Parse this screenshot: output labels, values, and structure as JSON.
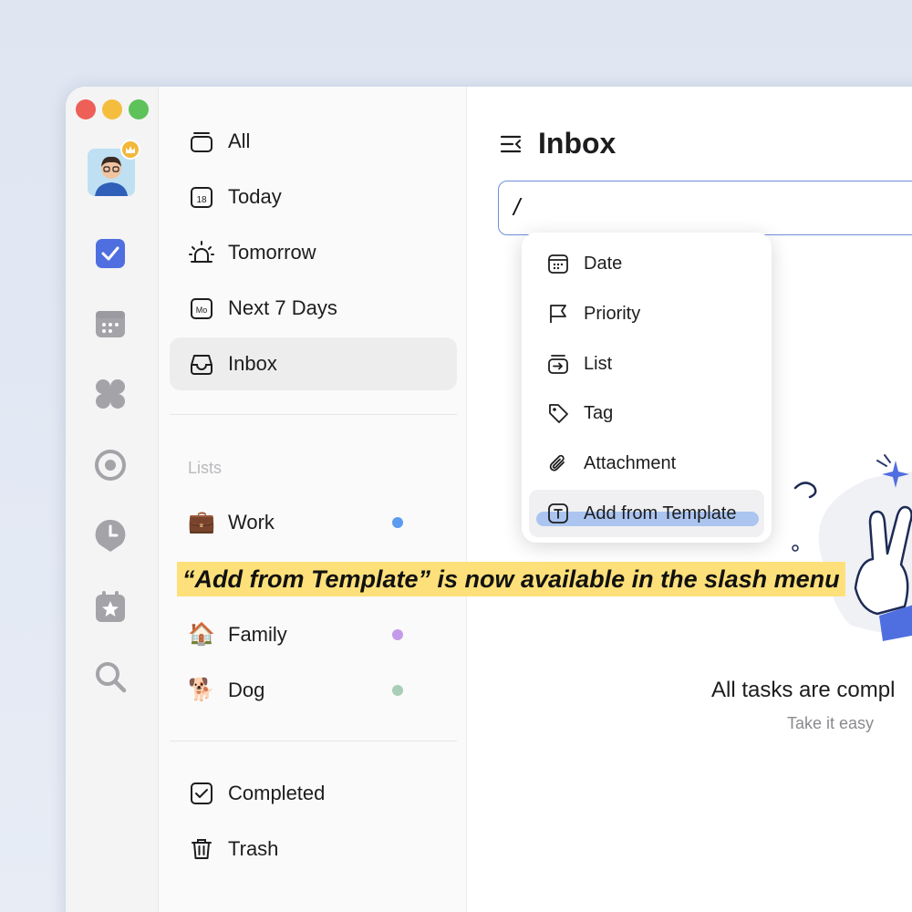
{
  "sidebar": {
    "smart_lists": [
      {
        "label": "All",
        "icon": "stack-icon"
      },
      {
        "label": "Today",
        "icon": "calendar-18-icon",
        "badge": "18"
      },
      {
        "label": "Tomorrow",
        "icon": "sunrise-icon"
      },
      {
        "label": "Next 7 Days",
        "icon": "calendar-mo-icon",
        "badge": "Mo"
      },
      {
        "label": "Inbox",
        "icon": "inbox-icon"
      }
    ],
    "lists_header": "Lists",
    "lists": [
      {
        "label": "Work",
        "emoji": "💼",
        "color": "#5b9cf0"
      },
      {
        "label": "Family",
        "emoji": "🏠",
        "color": "#c39bea"
      },
      {
        "label": "Dog",
        "emoji": "🐕",
        "color": "#a9cdb6"
      }
    ],
    "bottom": [
      {
        "label": "Completed",
        "icon": "checkbox-icon"
      },
      {
        "label": "Trash",
        "icon": "trash-icon"
      }
    ]
  },
  "main": {
    "title": "Inbox",
    "input_value": "/",
    "empty_title": "All tasks are compl",
    "empty_subtitle": "Take it easy"
  },
  "slash_menu": {
    "items": [
      {
        "label": "Date",
        "icon": "calendar-icon"
      },
      {
        "label": "Priority",
        "icon": "flag-icon"
      },
      {
        "label": "List",
        "icon": "list-move-icon"
      },
      {
        "label": "Tag",
        "icon": "tag-icon"
      },
      {
        "label": "Attachment",
        "icon": "paperclip-icon"
      },
      {
        "label": "Add from Template",
        "icon": "template-icon"
      }
    ]
  },
  "banner": "“Add from Template” is now available in the slash menu",
  "colors": {
    "accent": "#4f6fe0",
    "highlight": "#fde07a"
  }
}
